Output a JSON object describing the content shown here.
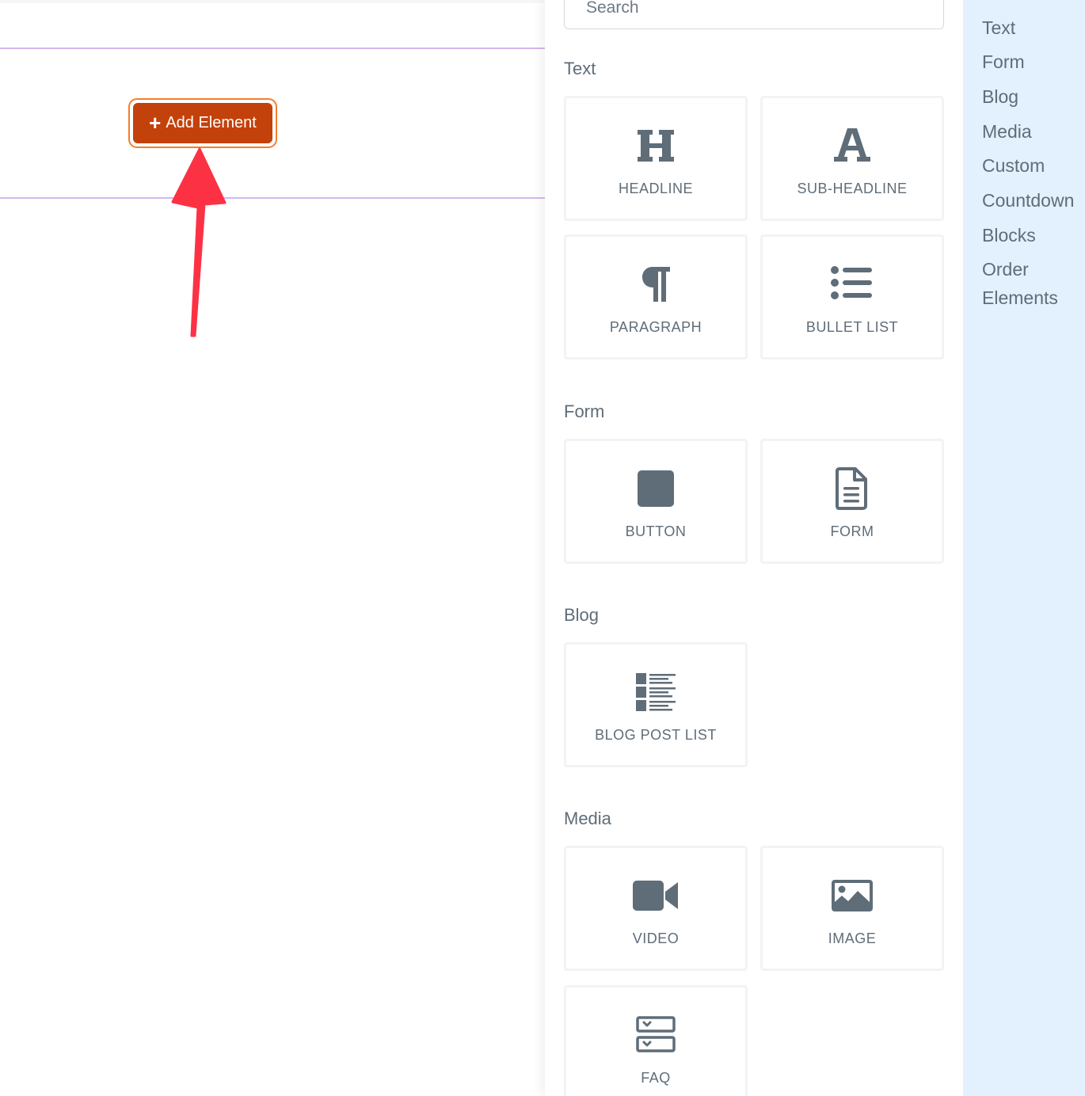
{
  "canvas": {
    "add_element_button": {
      "label": "Add Element",
      "icon": "plus-icon"
    },
    "colors": {
      "button": "#c3410b",
      "button_outline": "#f37f2a",
      "section_line": "#d3b7ef",
      "arrow": "#fc3244"
    }
  },
  "panel": {
    "search": {
      "placeholder": "Search"
    },
    "sections": {
      "text": {
        "title": "Text",
        "items": [
          {
            "label": "HEADLINE",
            "icon": "headline-icon"
          },
          {
            "label": "SUB-HEADLINE",
            "icon": "sub-headline-icon"
          },
          {
            "label": "PARAGRAPH",
            "icon": "paragraph-icon"
          },
          {
            "label": "BULLET LIST",
            "icon": "bullet-list-icon"
          }
        ]
      },
      "form": {
        "title": "Form",
        "items": [
          {
            "label": "BUTTON",
            "icon": "button-icon"
          },
          {
            "label": "FORM",
            "icon": "form-document-icon"
          }
        ]
      },
      "blog": {
        "title": "Blog",
        "items": [
          {
            "label": "BLOG POST LIST",
            "icon": "blog-post-list-icon"
          }
        ]
      },
      "media": {
        "title": "Media",
        "items": [
          {
            "label": "VIDEO",
            "icon": "video-camera-icon"
          },
          {
            "label": "IMAGE",
            "icon": "image-icon"
          },
          {
            "label": "FAQ",
            "icon": "faq-icon"
          }
        ]
      }
    },
    "colors": {
      "icon": "#5f6d78",
      "tile_border": "#f1f3f4"
    }
  },
  "nav": {
    "items": [
      {
        "label": "Text"
      },
      {
        "label": "Form"
      },
      {
        "label": "Blog"
      },
      {
        "label": "Media"
      },
      {
        "label": "Custom"
      },
      {
        "label": "Countdown"
      },
      {
        "label": "Blocks"
      },
      {
        "label": "Order Elements"
      }
    ],
    "background": "#e3f0fd"
  }
}
